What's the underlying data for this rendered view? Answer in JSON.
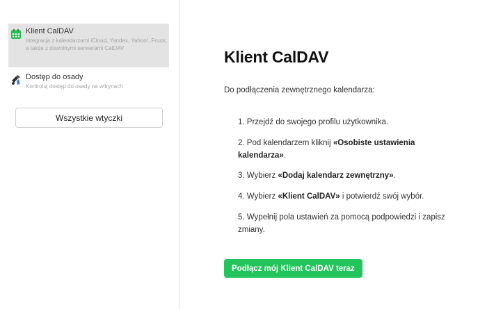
{
  "sidebar": {
    "items": [
      {
        "name": "Klient CalDAV",
        "description": "Integracja z kalendarzami iCloud, Yandex, Yahoo!, Fruux, a także z dowolnymi serwerami CalDAV",
        "icon": "calendar-icon",
        "active": true
      },
      {
        "name": "Dostęp do osady",
        "description": "Kontroluj dostęp do osady na witrynach",
        "icon": "pin-icon",
        "active": false
      }
    ],
    "all_plugins_label": "Wszystkie wtyczki"
  },
  "main": {
    "title": "Klient CalDAV",
    "intro": "Do podłączenia zewnętrznego kalendarza:",
    "steps": [
      {
        "num": "1.",
        "pre": "Przejdź do swojego profilu użytkownika.",
        "bold": "",
        "post": ""
      },
      {
        "num": "2.",
        "pre": "Pod kalendarzem kliknij ",
        "bold": "«Osobiste ustawienia kalendarza»",
        "post": "."
      },
      {
        "num": "3.",
        "pre": "Wybierz ",
        "bold": "«Dodaj kalendarz zewnętrzny»",
        "post": "."
      },
      {
        "num": "4.",
        "pre": "Wybierz ",
        "bold": "«Klient CalDAV»",
        "post": " i potwierdź swój wybór."
      },
      {
        "num": "5.",
        "pre": "Wypełnij pola ustawień za pomocą podpowiedzi i zapisz zmiany.",
        "bold": "",
        "post": ""
      }
    ],
    "cta_label": "Podłącz mój Klient CalDAV teraz"
  },
  "colors": {
    "accent": "#22c45b",
    "calendar_icon": "#2bbd57",
    "active_item_bg": "#e3e3e3"
  }
}
